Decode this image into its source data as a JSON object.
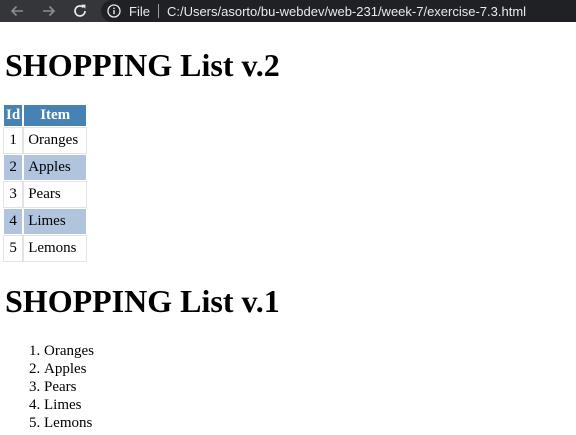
{
  "browser": {
    "scheme_label": "File",
    "url": "C:/Users/asorto/bu-webdev/web-231/week-7/exercise-7.3.html"
  },
  "page": {
    "table_heading": "SHOPPING List v.2",
    "table": {
      "headers": [
        "Id",
        "Item"
      ],
      "rows": [
        {
          "id": "1",
          "item": "Oranges"
        },
        {
          "id": "2",
          "item": "Apples"
        },
        {
          "id": "3",
          "item": "Pears"
        },
        {
          "id": "4",
          "item": "Limes"
        },
        {
          "id": "5",
          "item": "Lemons"
        }
      ]
    },
    "list_heading": "SHOPPING List v.1",
    "list_items": [
      "Oranges",
      "Apples",
      "Pears",
      "Limes",
      "Lemons"
    ]
  },
  "colors": {
    "table_header_bg": "#4682b4",
    "table_alt_row_bg": "#b0c4de",
    "chrome_bg": "#35363a",
    "omnibox_bg": "#202124"
  },
  "icons": [
    "back-arrow-icon",
    "forward-arrow-icon",
    "reload-icon",
    "info-icon"
  ]
}
